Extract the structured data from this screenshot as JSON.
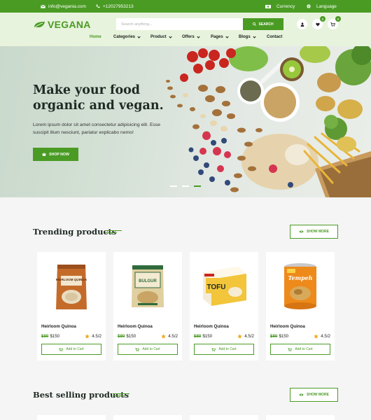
{
  "topbar": {
    "email": "info@vegania.com",
    "phone": "+12027953213",
    "currency": "Currency",
    "language": "Language"
  },
  "header": {
    "logo": "VEGANA",
    "search_placeholder": "Search anything...",
    "search_button": "SEARCH",
    "wishlist_count": "0",
    "cart_count": "0"
  },
  "nav": {
    "items": [
      {
        "label": "Home"
      },
      {
        "label": "Categories"
      },
      {
        "label": "Product"
      },
      {
        "label": "Offers"
      },
      {
        "label": "Pages"
      },
      {
        "label": "Blogs"
      },
      {
        "label": "Contact"
      }
    ]
  },
  "hero": {
    "title_line1": "Make your food",
    "title_line2": "organic and vegan.",
    "text_line1": "Lorem ipsum dolor sit amet consectetur adipisicing elit. Esse",
    "text_line2": "suscipit illum nesciunt, pariatur explicabo nemo!",
    "button": "SHOP NOW"
  },
  "trending": {
    "title": "Trending products",
    "show_more": "SHOW MORE",
    "products": [
      {
        "name": "Heirloom Quinoa",
        "old_price": "$80",
        "price": "$150",
        "rating": "4.5/2",
        "cart": "Add to Cart",
        "package_label": "HEIRLOOM QUINOA"
      },
      {
        "name": "Heirloom Quinoa",
        "old_price": "$80",
        "price": "$150",
        "rating": "4.5/2",
        "cart": "Add to Cart",
        "package_label": "BULGUR"
      },
      {
        "name": "Heirloom Quinoa",
        "old_price": "$80",
        "price": "$150",
        "rating": "4.5/2",
        "cart": "Add to Cart",
        "package_label": "TOFU"
      },
      {
        "name": "Heirloom Quinoa",
        "old_price": "$80",
        "price": "$150",
        "rating": "4.5/2",
        "cart": "Add to Cart",
        "package_label": "Tempeh"
      }
    ]
  },
  "best_selling": {
    "title": "Best selling products",
    "show_more": "SHOW MORE"
  },
  "colors": {
    "brand_green": "#4a9b24",
    "header_bg": "#e7f3dc",
    "page_bg": "#f5f5f5"
  }
}
